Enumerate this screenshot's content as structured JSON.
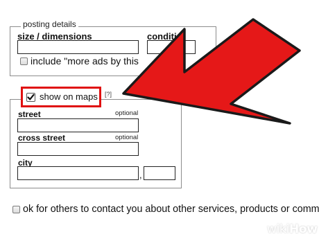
{
  "posting_details": {
    "legend": "posting details",
    "size_label": "size / dimensions",
    "size_value": "",
    "condition_label": "conditi",
    "condition_value": "",
    "more_ads_label": "include \"more ads by this"
  },
  "map_section": {
    "show_on_maps_label": "show on maps",
    "show_on_maps_checked": true,
    "help_glyph": "[?]",
    "street_label": "street",
    "street_optional": "optional",
    "street_value": "",
    "cross_street_label": "cross street",
    "cross_street_optional": "optional",
    "cross_street_value": "",
    "city_label": "city",
    "city_value": "",
    "city_separator": ",",
    "state_value": ""
  },
  "contact": {
    "label": "ok for others to contact you about other services, products or comm"
  },
  "annotation": {
    "highlight_color": "#e01010",
    "arrow_color": "#e01010"
  },
  "watermark": {
    "prefix": "wiki",
    "suffix": "How"
  }
}
